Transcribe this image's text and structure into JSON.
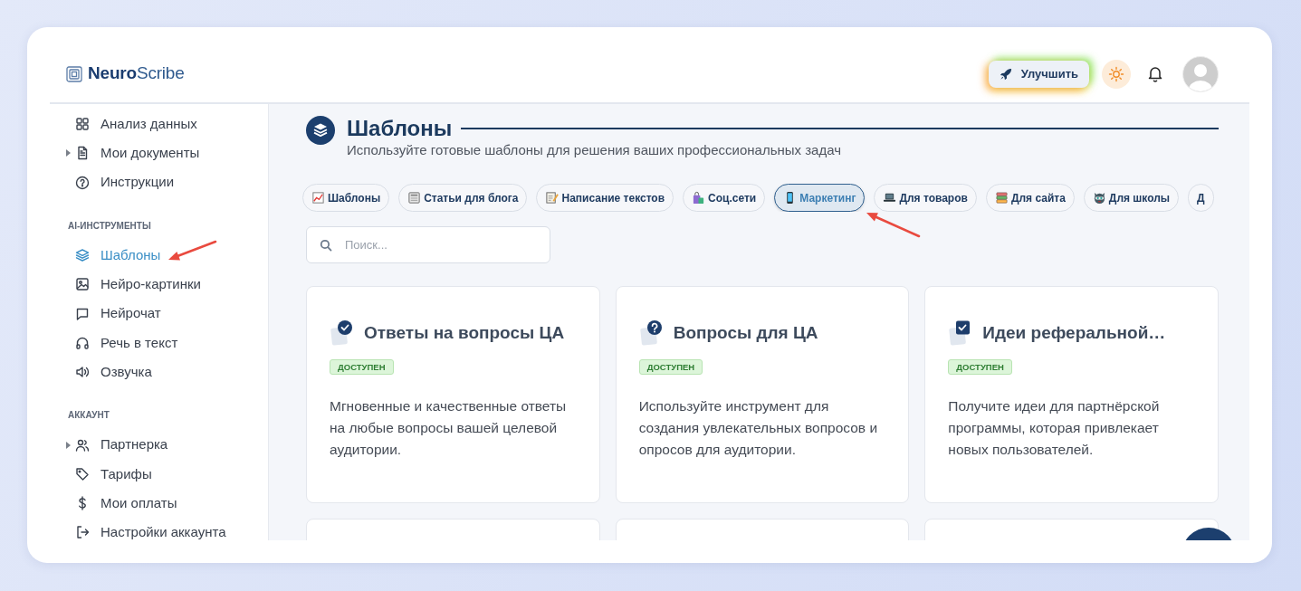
{
  "header": {
    "logo": "**Neuro**Scribe",
    "upgrade_button": "Улучшить"
  },
  "sidebar": {
    "sections": [
      {
        "items": [
          {
            "kind": "link",
            "label": "Анализ данных",
            "selected": false
          },
          {
            "kind": "group",
            "label": "Мои документы",
            "selected": false,
            "expanded": false
          },
          {
            "kind": "link",
            "label": "Инструкции",
            "selected": false
          }
        ]
      },
      {
        "title": "AI-ИНСТРУМЕНТЫ",
        "items": [
          {
            "kind": "link",
            "label": "Шаблоны",
            "selected": true
          },
          {
            "kind": "link",
            "label": "Нейро-картинки",
            "selected": false
          },
          {
            "kind": "link",
            "label": "Нейрочат",
            "selected": false
          },
          {
            "kind": "link",
            "label": "Речь в текст",
            "selected": false
          },
          {
            "kind": "link",
            "label": "Озвучка",
            "selected": false
          }
        ]
      },
      {
        "title": "АККАУНТ",
        "items": [
          {
            "kind": "group",
            "label": "Партнерка",
            "selected": false,
            "expanded": false
          },
          {
            "kind": "link",
            "label": "Тарифы",
            "selected": false
          },
          {
            "kind": "link",
            "label": "Мои оплаты",
            "selected": false
          },
          {
            "kind": "link",
            "label": "Настройки аккаунта",
            "selected": false
          }
        ]
      }
    ]
  },
  "page": {
    "title": "Шаблоны",
    "subtitle": "Используйте готовые шаблоны для решения ваших профессиональных задач"
  },
  "categories": [
    {
      "label": "Шаблоны",
      "selected": false
    },
    {
      "label": "Статьи для блога",
      "selected": false
    },
    {
      "label": "Написание текстов",
      "selected": false
    },
    {
      "label": "Соц.сети",
      "selected": false
    },
    {
      "label": "Маркетинг",
      "selected": true
    },
    {
      "label": "Для товаров",
      "selected": false
    },
    {
      "label": "Для сайта",
      "selected": false
    },
    {
      "label": "Для школы",
      "selected": false
    },
    {
      "label": "Д",
      "selected": false
    }
  ],
  "search": {
    "placeholder": "Поиск..."
  },
  "templates": [
    {
      "kind": "full",
      "title": "Ответы на вопросы ЦА",
      "status": "ДОСТУПЕН",
      "description": "Мгновенные и качественные ответы на любые вопросы вашей целевой аудитории."
    },
    {
      "kind": "full",
      "title": "Вопросы для ЦА",
      "status": "ДОСТУПЕН",
      "description": "Используйте инструмент для создания увлекательных вопросов и опросов для аудитории."
    },
    {
      "kind": "full",
      "title": "Идеи реферальной…",
      "status": "ДОСТУПЕН",
      "description": "Получите идеи для партнёрской программы, которая привлекает новых пользователей."
    },
    {
      "kind": "clipped"
    },
    {
      "kind": "clipped"
    },
    {
      "kind": "clipped"
    }
  ]
}
